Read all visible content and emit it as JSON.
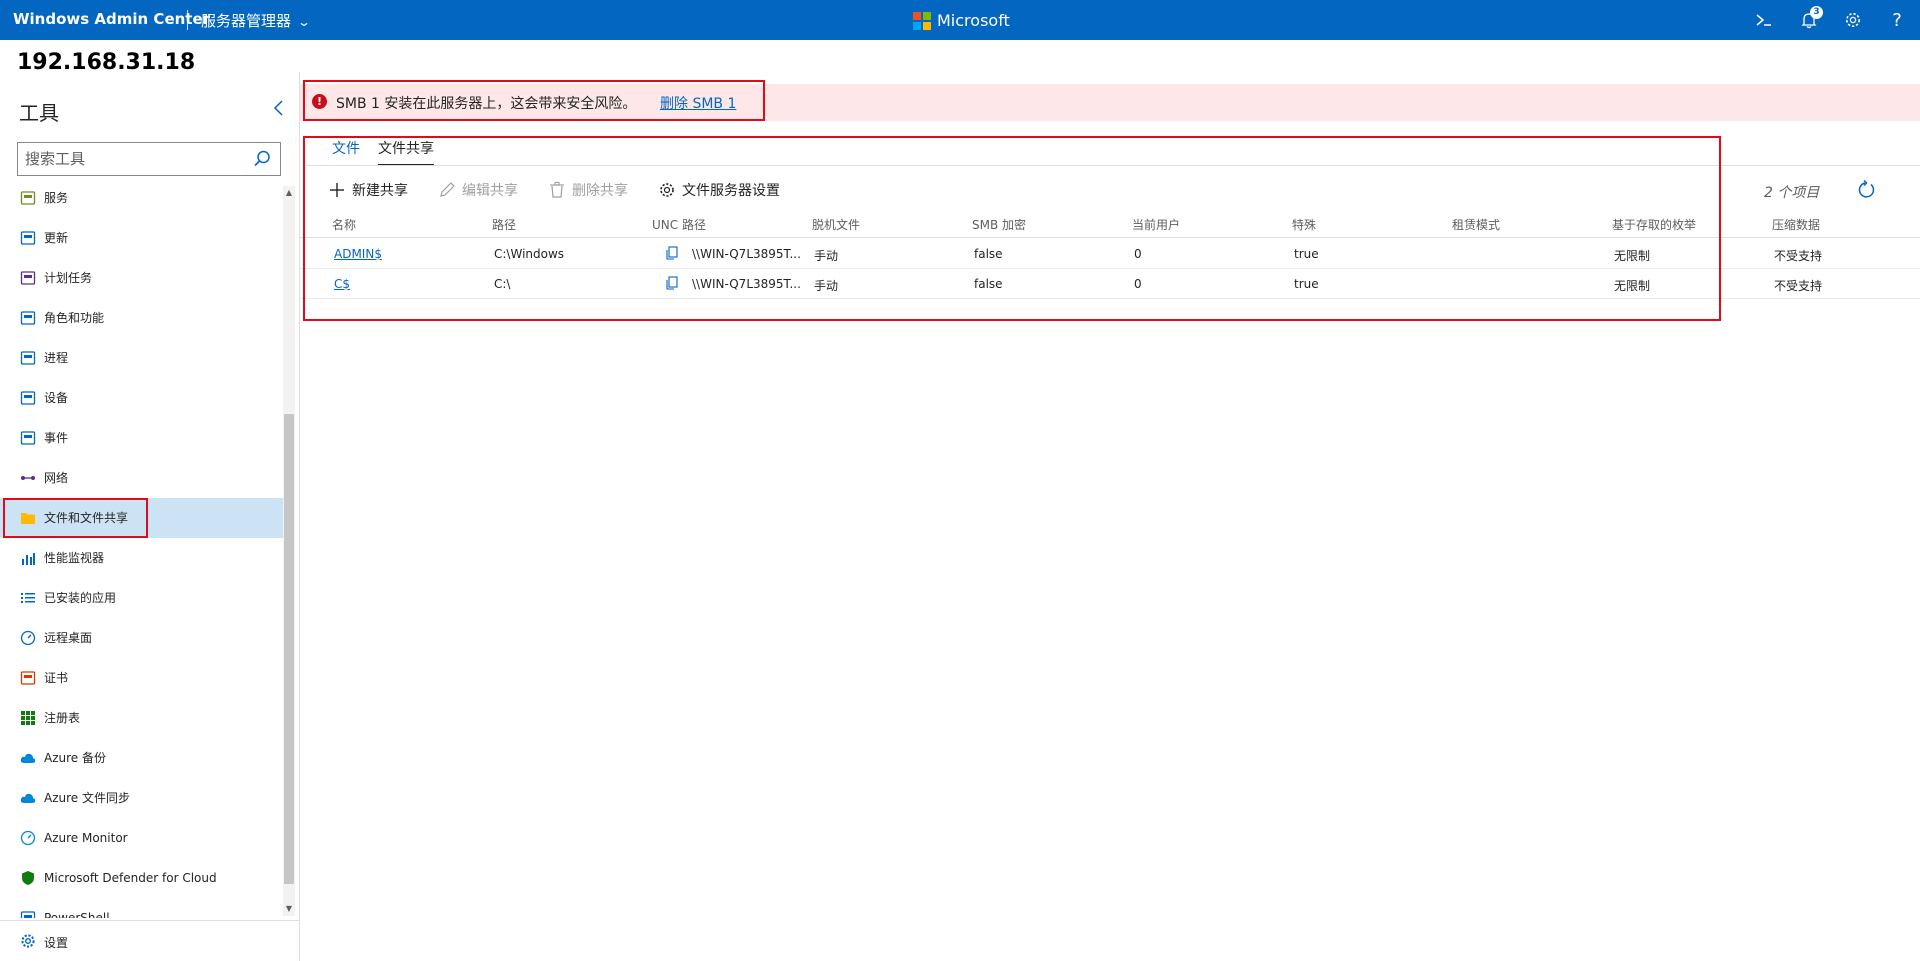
{
  "topbar": {
    "app_title": "Windows Admin Center",
    "context": "服务器管理器",
    "brand": "Microsoft",
    "notification_count": "3",
    "brand_colors": [
      "#f25022",
      "#7fba00",
      "#00a4ef",
      "#ffb900"
    ]
  },
  "server": {
    "name": "192.168.31.18"
  },
  "tools": {
    "title": "工具",
    "search_placeholder": "搜索工具",
    "items": [
      {
        "label": "服务",
        "icon": "services-icon"
      },
      {
        "label": "更新",
        "icon": "updates-icon"
      },
      {
        "label": "计划任务",
        "icon": "scheduled-tasks-icon"
      },
      {
        "label": "角色和功能",
        "icon": "roles-features-icon"
      },
      {
        "label": "进程",
        "icon": "processes-icon"
      },
      {
        "label": "设备",
        "icon": "devices-icon"
      },
      {
        "label": "事件",
        "icon": "events-icon"
      },
      {
        "label": "网络",
        "icon": "network-icon"
      },
      {
        "label": "文件和文件共享",
        "icon": "folder-icon",
        "active": true
      },
      {
        "label": "性能监视器",
        "icon": "performance-monitor-icon"
      },
      {
        "label": "已安装的应用",
        "icon": "installed-apps-icon"
      },
      {
        "label": "远程桌面",
        "icon": "remote-desktop-icon"
      },
      {
        "label": "证书",
        "icon": "certificates-icon"
      },
      {
        "label": "注册表",
        "icon": "registry-icon"
      },
      {
        "label": "Azure 备份",
        "icon": "azure-backup-icon"
      },
      {
        "label": "Azure 文件同步",
        "icon": "azure-file-sync-icon"
      },
      {
        "label": "Azure Monitor",
        "icon": "azure-monitor-icon"
      },
      {
        "label": "Microsoft Defender for Cloud",
        "icon": "defender-icon"
      },
      {
        "label": "PowerShell",
        "icon": "powershell-icon"
      }
    ],
    "settings_label": "设置"
  },
  "alert": {
    "message": "SMB 1 安装在此服务器上，这会带来安全风险。",
    "link": "删除 SMB 1"
  },
  "tabs": [
    "文件",
    "文件共享"
  ],
  "toolbar": {
    "new_share": "新建共享",
    "edit_share": "编辑共享",
    "delete_share": "删除共享",
    "server_settings": "文件服务器设置",
    "item_count": "2 个项目"
  },
  "table": {
    "columns": [
      "名称",
      "路径",
      "UNC 路径",
      "脱机文件",
      "SMB 加密",
      "当前用户",
      "特殊",
      "租赁模式",
      "基于存取的枚举",
      "压缩数据"
    ],
    "rows": [
      [
        "ADMIN$",
        "C:\\Windows",
        "\\\\WIN-Q7L3895T...",
        "手动",
        "false",
        "0",
        "true",
        "",
        "无限制",
        "不受支持"
      ],
      [
        "C$",
        "C:\\",
        "\\\\WIN-Q7L3895T...",
        "手动",
        "false",
        "0",
        "true",
        "",
        "无限制",
        "不受支持"
      ]
    ]
  }
}
